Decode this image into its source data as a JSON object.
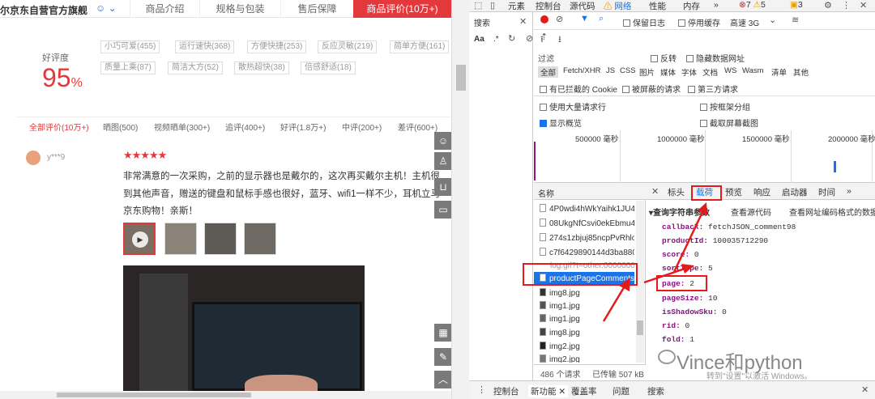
{
  "page": {
    "shop_name": "尔京东自营官方旗舰",
    "tabs": [
      "商品介绍",
      "规格与包装",
      "售后保障",
      "商品评价(10万+)"
    ],
    "score_label": "好评度",
    "score_value": "95",
    "score_unit": "%",
    "tags": [
      "小巧可爱(455)",
      "运行速快(368)",
      "方便快捷(253)",
      "反应灵敏(219)",
      "简单方便(161)",
      "质量上乘(87)",
      "简洁大方(52)",
      "散热超快(38)",
      "倍感舒适(18)"
    ],
    "filters": [
      "全部评价(10万+)",
      "晒图(500)",
      "视频晒单(300+)",
      "追评(400+)",
      "好评(1.8万+)",
      "中评(200+)",
      "差评(600+)"
    ],
    "review": {
      "user": "y***9",
      "stars": "★★★★★",
      "lines": [
        "非常满意的一次采购，之前的显示器也是戴尔的，这次再买戴尔主机！主机很",
        "到其他声音，赠送的键盘和鼠标手感也很好，蓝牙、wifi1一样不少，耳机立马",
        "京东购物！亲斯！"
      ]
    }
  },
  "devtools": {
    "tabs": [
      "元素",
      "控制台",
      "源代码",
      "网络",
      "性能",
      "内存",
      "»"
    ],
    "active_tab": "网络",
    "error_count": "7",
    "warn_count": "5",
    "info_count": "3",
    "search_tab": "搜索",
    "toolbar": {
      "preserve_log": "保留日志",
      "disable_cache": "停用缓存",
      "throttle": "高速 3G"
    },
    "filter_placeholder": "过滤",
    "invert": "反转",
    "hide_data_urls": "隐藏数据网址",
    "types": [
      "全部",
      "Fetch/XHR",
      "JS",
      "CSS",
      "图片",
      "媒体",
      "字体",
      "文档",
      "WS",
      "Wasm",
      "清单",
      "其他"
    ],
    "blocked_cookies": "有已拦截的 Cookie",
    "blocked_requests": "被屏蔽的请求",
    "third_party": "第三方请求",
    "large_rows": "使用大量请求行",
    "group_by_frame": "按框架分组",
    "show_overview": "显示概览",
    "capture_screenshots": "截取屏幕截图",
    "timeline": [
      "500000 毫秒",
      "1000000 毫秒",
      "1500000 毫秒",
      "2000000 毫秒"
    ],
    "name_header": "名称",
    "requests": [
      "4P0wdi4hWkYaihk1JU46",
      "08UkgNfCsvi0ekEbmu4_",
      "274s1zbjuj85ncpPvRhlol",
      "c7f6429890144d3ba880",
      "log.gif?t=other.0000000",
      "productPageComments.",
      "img8.jpg",
      "img1.jpg",
      "img1.jpg",
      "img8.jpg",
      "img2.jpg",
      "img2.jpg"
    ],
    "status": {
      "count": "486 个请求",
      "transferred": "已传输 507 kB"
    },
    "detail_tabs": [
      "标头",
      "载荷",
      "预览",
      "响应",
      "启动器",
      "时间",
      "»"
    ],
    "query_header": "查询字符串参数",
    "view_source": "查看源代码",
    "view_encoded": "查看网址编码格式的数据",
    "params": [
      {
        "k": "callback:",
        "v": "fetchJSON_comment98"
      },
      {
        "k": "productId:",
        "v": "100035712290"
      },
      {
        "k": "score:",
        "v": "0"
      },
      {
        "k": "sortType:",
        "v": "5"
      },
      {
        "k": "page:",
        "v": "2"
      },
      {
        "k": "pageSize:",
        "v": "10"
      },
      {
        "k": "isShadowSku:",
        "v": "0"
      },
      {
        "k": "rid:",
        "v": "0"
      },
      {
        "k": "fold:",
        "v": "1"
      }
    ],
    "drawer_tabs": [
      "控制台",
      "新功能",
      "覆盖率",
      "问题",
      "搜索"
    ],
    "watermark": "Vince和python",
    "activation": "转到\"设置\"以激活 Windows。"
  },
  "colors": {
    "jd_red": "#e4393c",
    "accent": "#1a73e8",
    "annotation": "#e41b1b"
  }
}
